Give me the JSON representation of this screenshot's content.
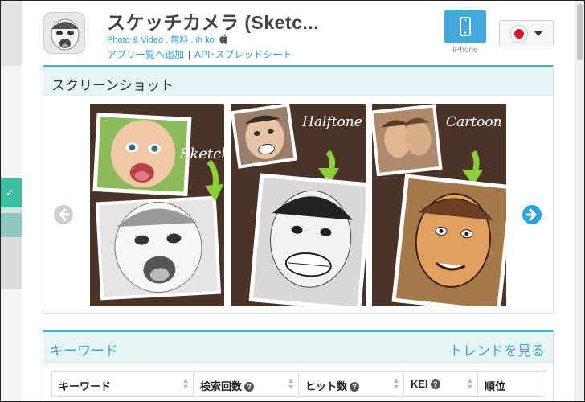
{
  "app": {
    "title": "スケッチカメラ (Sketc...",
    "category": "Photo & Video",
    "price": "無料",
    "developer": "ih ko",
    "platform_icon": "apple-icon",
    "add_to_list": "アプリ一覧へ追加",
    "api_link": "API･スプレッドシート",
    "links_divider": "|"
  },
  "device": {
    "label": "iPhone",
    "icon": "smartphone-icon"
  },
  "country": {
    "flag": "japan-flag-icon"
  },
  "screenshots": {
    "title": "スクリーンショット",
    "items": [
      {
        "label": "Sketch"
      },
      {
        "label": "Halftone"
      },
      {
        "label": "Cartoon"
      }
    ],
    "prev_icon": "arrow-left-circle-icon",
    "next_icon": "arrow-right-circle-icon"
  },
  "keywords": {
    "title": "キーワード",
    "trend_link": "トレンドを見る",
    "columns": [
      {
        "label": "キーワード",
        "help": false
      },
      {
        "label": "検索回数",
        "help": true
      },
      {
        "label": "ヒット数",
        "help": true
      },
      {
        "label": "KEI",
        "help": true
      },
      {
        "label": "順位",
        "help": false
      }
    ]
  },
  "colors": {
    "accent_blue": "#2a9fd0",
    "header_teal": "#3ab5d3",
    "device_button": "#45a8dc",
    "sidebar_green": "#3cbfa0",
    "flag_red": "#d9162e"
  }
}
